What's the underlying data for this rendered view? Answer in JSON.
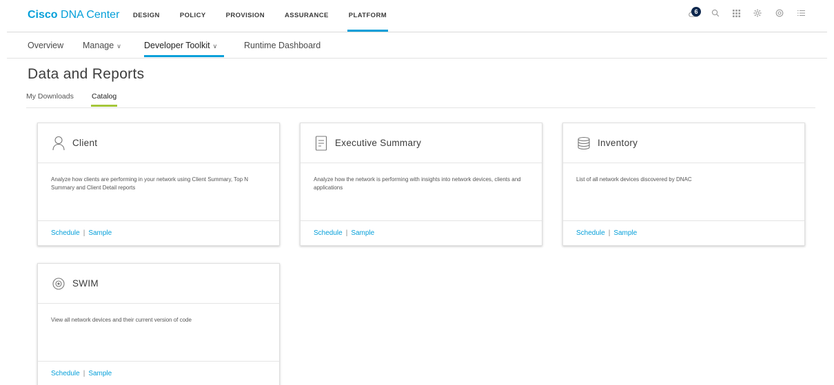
{
  "brand": {
    "bold": "Cisco",
    "rest": "DNA Center"
  },
  "nav": [
    "DESIGN",
    "POLICY",
    "PROVISION",
    "ASSURANCE",
    "PLATFORM"
  ],
  "nav_active": "PLATFORM",
  "notifications": {
    "count": "6"
  },
  "top_icons": [
    "cloud-icon",
    "search-icon",
    "apps-grid-icon",
    "settings-icon",
    "help-icon",
    "menu-list-icon"
  ],
  "subnav": {
    "overview": "Overview",
    "manage": "Manage",
    "developer_toolkit": "Developer Toolkit",
    "runtime_dashboard": "Runtime Dashboard",
    "chevron": "∨"
  },
  "page": {
    "title": "Data and Reports",
    "tabs": [
      "My Downloads",
      "Catalog"
    ],
    "active_tab": "Catalog"
  },
  "cards": [
    {
      "title": "Client",
      "icon": "person-icon",
      "description": "Analyze how clients are performing in your network using Client Summary, Top N Summary and Client Detail reports",
      "schedule": "Schedule",
      "sample": "Sample",
      "sep": "|"
    },
    {
      "title": "Executive Summary",
      "icon": "document-icon",
      "description": "Analyze how the network is performing with insights into network devices, clients and applications",
      "schedule": "Schedule",
      "sample": "Sample",
      "sep": "|"
    },
    {
      "title": "Inventory",
      "icon": "database-icon",
      "description": "List of all network devices discovered by DNAC",
      "schedule": "Schedule",
      "sample": "Sample",
      "sep": "|"
    },
    {
      "title": "SWIM",
      "icon": "disc-icon",
      "description": "View all network devices and their current version of code",
      "schedule": "Schedule",
      "sample": "Sample",
      "sep": "|"
    }
  ],
  "colors": {
    "accent": "#049fd9",
    "tab_underline": "#a4c639",
    "badge": "#0d274d"
  }
}
